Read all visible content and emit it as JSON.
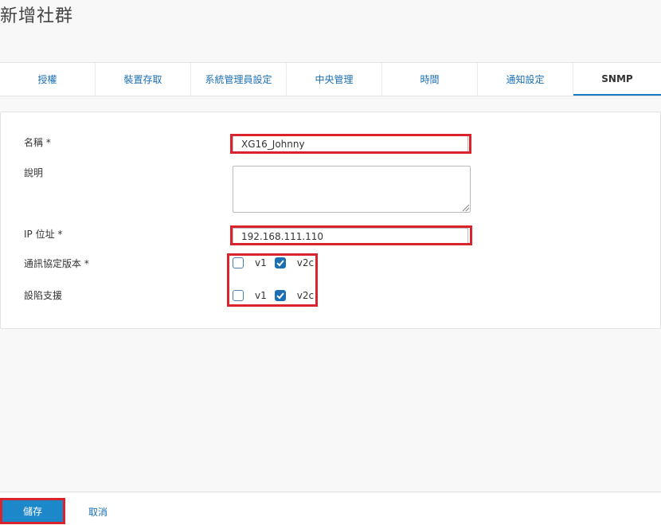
{
  "page_title": "新增社群",
  "tabs": [
    {
      "label": "授權"
    },
    {
      "label": "裝置存取"
    },
    {
      "label": "系統管理員設定"
    },
    {
      "label": "中央管理"
    },
    {
      "label": "時間"
    },
    {
      "label": "通知設定"
    },
    {
      "label": "SNMP"
    }
  ],
  "active_tab": "SNMP",
  "form": {
    "name_label": "名稱 *",
    "name_value": "XG16_Johnny",
    "description_label": "說明",
    "description_value": "",
    "ip_label": "IP 位址 *",
    "ip_value": "192.168.111.110",
    "protocol_label": "通訊協定版本 *",
    "protocol_v1_label": "v1",
    "protocol_v1_checked": false,
    "protocol_v2c_label": "v2c",
    "protocol_v2c_checked": true,
    "trap_label": "設陷支援",
    "trap_v1_label": "v1",
    "trap_v1_checked": false,
    "trap_v2c_label": "v2c",
    "trap_v2c_checked": true
  },
  "footer": {
    "save_label": "儲存",
    "cancel_label": "取消"
  },
  "colors": {
    "accent": "#1a6fb5",
    "highlight": "#d9232d",
    "button": "#1c87c9"
  }
}
